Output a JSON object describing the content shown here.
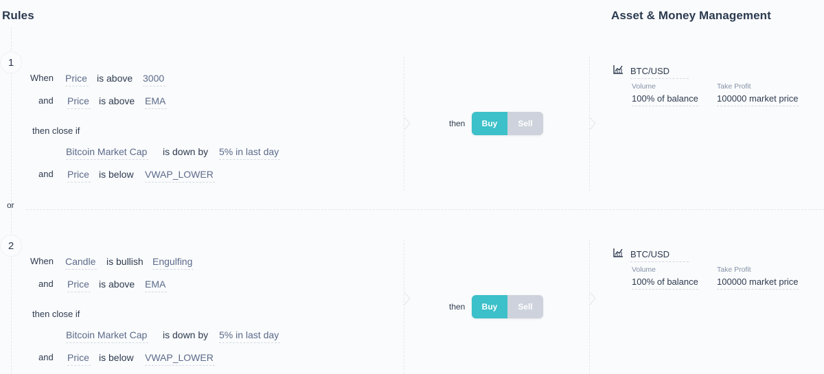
{
  "header": {
    "rules_title": "Rules",
    "asset_title": "Asset & Money Management"
  },
  "or_label": "or",
  "rules": [
    {
      "number": "1",
      "when_label": "When",
      "conditions": [
        {
          "indicator": "Price",
          "operator": "is above",
          "value": "3000"
        },
        {
          "connector": "and",
          "indicator": "Price",
          "operator": "is above",
          "value": "EMA"
        }
      ],
      "close_label": "then close if",
      "close_conditions": [
        {
          "indicator": "Bitcoin Market Cap",
          "operator": "is down by",
          "value": "5% in last day"
        },
        {
          "connector": "and",
          "indicator": "Price",
          "operator": "is below",
          "value": "VWAP_LOWER"
        }
      ],
      "then_label": "then",
      "buy_label": "Buy",
      "sell_label": "Sell",
      "selected_side": "Buy",
      "asset": {
        "icon": "chart-icon",
        "pair": "BTC/USD",
        "volume_label": "Volume",
        "volume_value": "100% of balance",
        "take_profit_label": "Take Profit",
        "take_profit_value": "100000 market price"
      }
    },
    {
      "number": "2",
      "when_label": "When",
      "conditions": [
        {
          "indicator": "Candle",
          "operator": "is bullish",
          "value": "Engulfing"
        },
        {
          "connector": "and",
          "indicator": "Price",
          "operator": "is above",
          "value": "EMA"
        }
      ],
      "close_label": "then close if",
      "close_conditions": [
        {
          "indicator": "Bitcoin Market Cap",
          "operator": "is down by",
          "value": "5% in last day"
        },
        {
          "connector": "and",
          "indicator": "Price",
          "operator": "is below",
          "value": "VWAP_LOWER"
        }
      ],
      "then_label": "then",
      "buy_label": "Buy",
      "sell_label": "Sell",
      "selected_side": "Buy",
      "asset": {
        "icon": "chart-icon",
        "pair": "BTC/USD",
        "volume_label": "Volume",
        "volume_value": "100% of balance",
        "take_profit_label": "Take Profit",
        "take_profit_value": "100000 market price"
      }
    }
  ],
  "colors": {
    "buy_active": "#3cc0c9",
    "sell_inactive": "#cdd2dc",
    "text_primary": "#2d3a4f",
    "text_value": "#5b6a8a"
  }
}
